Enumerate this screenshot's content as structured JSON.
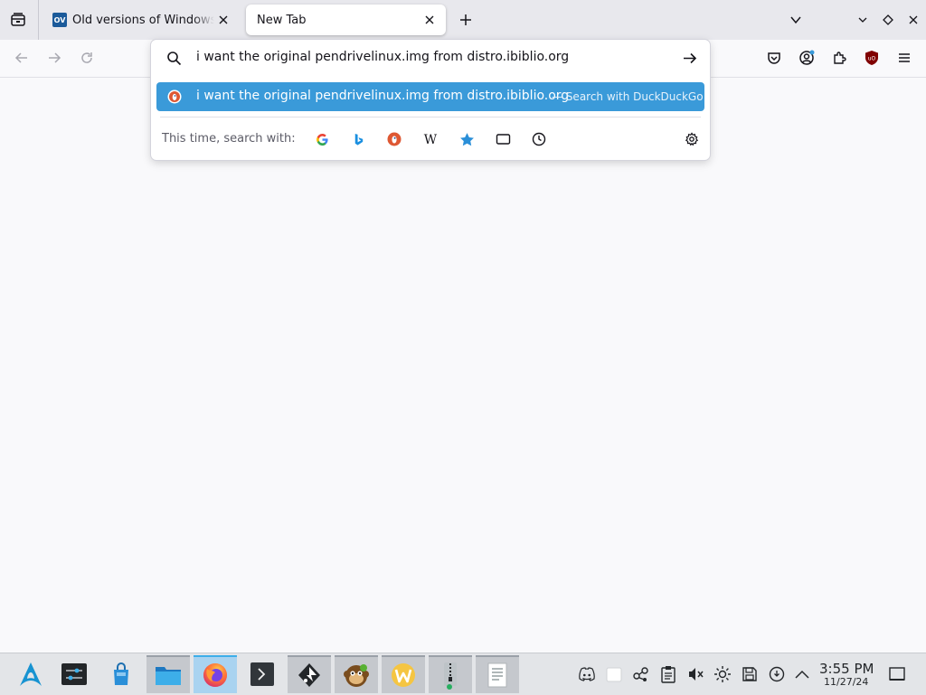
{
  "tabs": [
    {
      "title": "Old versions of Windows, Mac, Linux",
      "favicon_text": "OV"
    },
    {
      "title": "New Tab"
    }
  ],
  "urlbar": {
    "value": "i want the original pendrivelinux.img from distro.ibiblio.org"
  },
  "results": [
    {
      "text": "i want the original pendrivelinux.img from distro.ibiblio.org",
      "action": "— Search with DuckDuckGo",
      "engine_icon": "duckduckgo-icon"
    }
  ],
  "search_with": {
    "label": "This time, search with:",
    "engines": [
      "google-icon",
      "bing-icon",
      "duckduckgo-icon",
      "wikipedia-icon",
      "bookmarks-icon",
      "tabs-icon",
      "history-icon"
    ]
  },
  "toolbar_icons": [
    "pocket-icon",
    "account-icon",
    "extensions-icon",
    "ublock-origin-icon",
    "menu-icon"
  ],
  "taskbar": {
    "apps": [
      "arch-launcher-icon",
      "system-settings-icon",
      "discover-store-icon",
      "file-manager-icon",
      "firefox-icon",
      "terminal-icon",
      "inkscape-icon",
      "monkey-app-icon",
      "w-app-icon",
      "archive-manager-icon",
      "text-editor-icon"
    ],
    "tray": [
      "discord-icon",
      "clipboard-blank-icon",
      "network-icon",
      "clipboard-icon",
      "volume-muted-icon",
      "brightness-icon",
      "storage-icon",
      "update-icon",
      "tray-expand-icon"
    ],
    "clock": {
      "time": "3:55 PM",
      "date": "11/27/24"
    }
  },
  "colors": {
    "accent": "#3a9ad9",
    "tab_strip": "#e8e8ed",
    "taskbar": "#e3e5e8",
    "ublock_red": "#800000"
  }
}
